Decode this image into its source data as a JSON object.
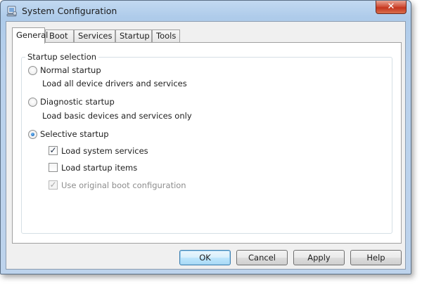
{
  "window": {
    "title": "System Configuration",
    "close_glyph": "✕",
    "icon": "system-config-icon"
  },
  "tabs": [
    {
      "label": "General",
      "active": true
    },
    {
      "label": "Boot",
      "active": false
    },
    {
      "label": "Services",
      "active": false
    },
    {
      "label": "Startup",
      "active": false
    },
    {
      "label": "Tools",
      "active": false
    }
  ],
  "startup_selection": {
    "group_label": "Startup selection",
    "normal": {
      "label": "Normal startup",
      "description": "Load all device drivers and services",
      "selected": false
    },
    "diagnostic": {
      "label": "Diagnostic startup",
      "description": "Load basic devices and services only",
      "selected": false
    },
    "selective": {
      "label": "Selective startup",
      "selected": true,
      "options": {
        "load_system_services": {
          "label": "Load system services",
          "checked": true,
          "enabled": true
        },
        "load_startup_items": {
          "label": "Load startup items",
          "checked": false,
          "enabled": true
        },
        "use_original_boot": {
          "label": "Use original boot configuration",
          "checked": true,
          "enabled": false
        }
      }
    }
  },
  "buttons": {
    "ok": "OK",
    "cancel": "Cancel",
    "apply": "Apply",
    "help": "Help"
  },
  "check_glyph": "✓"
}
